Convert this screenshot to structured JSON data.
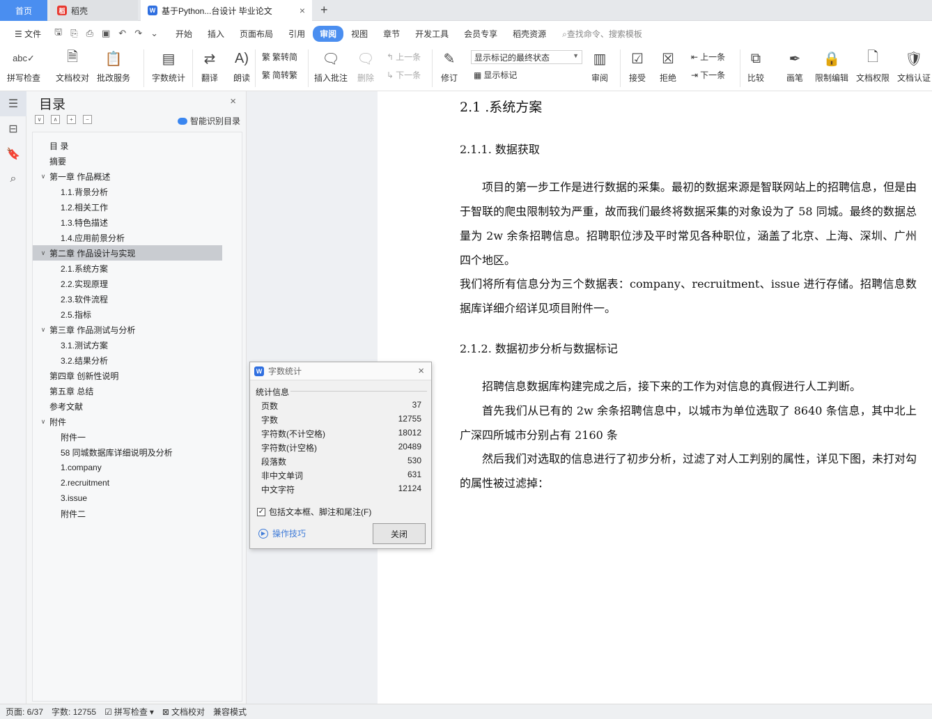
{
  "tabs": {
    "home": "首页",
    "doc1": "稻壳",
    "doc2": "基于Python...台设计 毕业论文"
  },
  "menu": {
    "file": "文件",
    "items": [
      "开始",
      "插入",
      "页面布局",
      "引用",
      "审阅",
      "视图",
      "章节",
      "开发工具",
      "会员专享",
      "稻壳资源"
    ],
    "active_index": 4,
    "search": "查找命令、搜索模板"
  },
  "ribbon": {
    "spellcheck": "拼写检查",
    "doc_check": "文档校对",
    "batch": "批改服务",
    "wordcount": "字数统计",
    "translate": "翻译",
    "read": "朗读",
    "to_trad": "繁转简",
    "to_simp": "简转繁",
    "insert_comment": "插入批注",
    "delete": "删除",
    "prev": "上一条",
    "next": "下一条",
    "track": "修订",
    "mode_combo": "显示标记的最终状态",
    "show_marks": "显示标记",
    "review": "审阅",
    "accept": "接受",
    "reject": "拒绝",
    "prev2": "上一条",
    "next2": "下一条",
    "compare": "比较",
    "pen": "画笔",
    "restrict": "限制编辑",
    "rights": "文档权限",
    "auth": "文档认证"
  },
  "toc": {
    "title": "目录",
    "smart": "智能识别目录",
    "items": [
      {
        "label": "目 录",
        "level": 0,
        "chev": ""
      },
      {
        "label": "摘要",
        "level": 0,
        "chev": ""
      },
      {
        "label": "第一章 作品概述",
        "level": 0,
        "chev": "∨"
      },
      {
        "label": "1.1.背景分析",
        "level": 1,
        "chev": ""
      },
      {
        "label": "1.2.相关工作",
        "level": 1,
        "chev": ""
      },
      {
        "label": "1.3.特色描述",
        "level": 1,
        "chev": ""
      },
      {
        "label": "1.4.应用前景分析",
        "level": 1,
        "chev": ""
      },
      {
        "label": "第二章 作品设计与实现",
        "level": 0,
        "chev": "∨",
        "selected": true
      },
      {
        "label": "2.1.系统方案",
        "level": 1,
        "chev": ""
      },
      {
        "label": "2.2.实现原理",
        "level": 1,
        "chev": ""
      },
      {
        "label": "2.3.软件流程",
        "level": 1,
        "chev": ""
      },
      {
        "label": "2.5.指标",
        "level": 1,
        "chev": ""
      },
      {
        "label": "第三章 作品测试与分析",
        "level": 0,
        "chev": "∨"
      },
      {
        "label": "3.1.测试方案",
        "level": 1,
        "chev": ""
      },
      {
        "label": "3.2.结果分析",
        "level": 1,
        "chev": ""
      },
      {
        "label": "第四章 创新性说明",
        "level": 0,
        "chev": ""
      },
      {
        "label": "第五章 总结",
        "level": 0,
        "chev": ""
      },
      {
        "label": "参考文献",
        "level": 0,
        "chev": ""
      },
      {
        "label": "附件",
        "level": 0,
        "chev": "∨"
      },
      {
        "label": "附件一",
        "level": 1,
        "chev": ""
      },
      {
        "label": "58 同城数据库详细说明及分析",
        "level": 1,
        "chev": ""
      },
      {
        "label": "1.company",
        "level": 1,
        "chev": ""
      },
      {
        "label": "2.recruitment",
        "level": 1,
        "chev": ""
      },
      {
        "label": "3.issue",
        "level": 1,
        "chev": ""
      },
      {
        "label": "附件二",
        "level": 1,
        "chev": ""
      }
    ]
  },
  "doc": {
    "h1": "2.1 .系统方案",
    "h2a": "2.1.1.   数据获取",
    "p1": "项目的第一步工作是进行数据的采集。最初的数据来源是智联网站上的招聘信息，但是由于智联的爬虫限制较为严重，故而我们最终将数据采集的对象设为了 58 同城。最终的数据总量为 2w 余条招聘信息。招聘职位涉及平时常见各种职位，涵盖了北京、上海、深圳、广州四个地区。",
    "p2": "我们将所有信息分为三个数据表：company、recruitment、issue 进行存储。招聘信息数据库详细介绍详见项目附件一。",
    "h2b": "2.1.2.   数据初步分析与数据标记",
    "p3": "招聘信息数据库构建完成之后，接下来的工作为对信息的真假进行人工判断。",
    "p4": "首先我们从已有的 2w 余条招聘信息中，以城市为单位选取了 8640 条信息，其中北上广深四所城市分别占有 2160 条",
    "p5": "然后我们对选取的信息进行了初步分析，过滤了对人工判别的属性，详见下图，未打对勾的属性被过滤掉："
  },
  "dialog": {
    "title": "字数统计",
    "section": "统计信息",
    "rows": [
      {
        "k": "页数",
        "v": "37"
      },
      {
        "k": "字数",
        "v": "12755"
      },
      {
        "k": "字符数(不计空格)",
        "v": "18012"
      },
      {
        "k": "字符数(计空格)",
        "v": "20489"
      },
      {
        "k": "段落数",
        "v": "530"
      },
      {
        "k": "非中文单词",
        "v": "631"
      },
      {
        "k": "中文字符",
        "v": "12124"
      }
    ],
    "include": "包括文本框、脚注和尾注(F)",
    "include_checked": true,
    "tips": "操作技巧",
    "close": "关闭"
  },
  "status": {
    "page": "页面: 6/37",
    "words": "字数: 12755",
    "spell": "拼写检查",
    "proof": "文档校对",
    "compat": "兼容模式"
  }
}
